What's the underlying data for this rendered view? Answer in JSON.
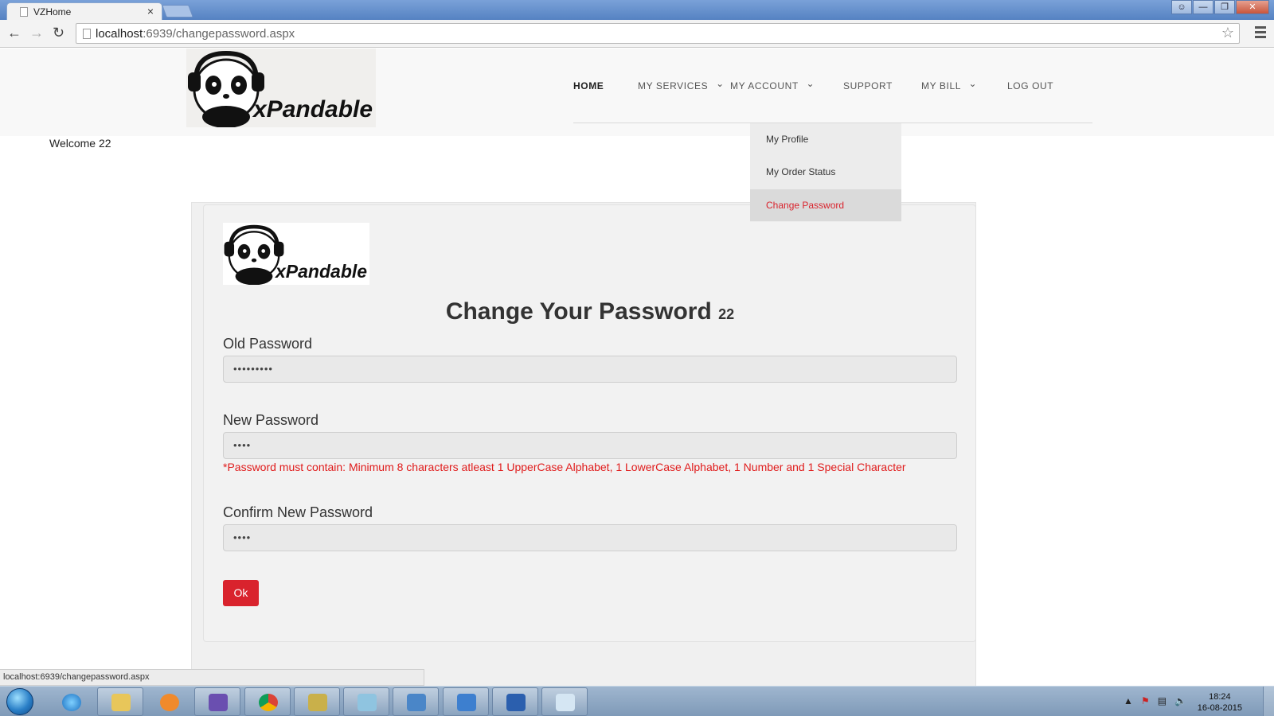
{
  "browser": {
    "tab_title": "VZHome",
    "tab_close": "×",
    "url_host": "localhost",
    "url_rest": ":6939/changepassword.aspx",
    "status_url": "localhost:6939/changepassword.aspx"
  },
  "header": {
    "logo_text": "xPandable",
    "nav": [
      {
        "label": "HOME",
        "active": true
      },
      {
        "label": "MY SERVICES",
        "caret": true
      },
      {
        "label": "MY ACCOUNT",
        "caret": true
      },
      {
        "label": "SUPPORT"
      },
      {
        "label": "MY BILL",
        "caret": true
      },
      {
        "label": "LOG OUT"
      }
    ],
    "caret": "⌄"
  },
  "welcome": "Welcome 22",
  "dropdown": {
    "items": [
      {
        "label": "My Profile"
      },
      {
        "label": "My Order Status"
      },
      {
        "label": "Change Password",
        "active": true
      }
    ]
  },
  "form": {
    "logo_text": "xPandable",
    "heading": "Change Your Password",
    "heading_user": "22",
    "old_label": "Old Password",
    "old_value": "•••••••••",
    "new_label": "New Password",
    "new_value": "••••",
    "error": "*Password must contain: Minimum 8 characters atleast 1 UpperCase Alphabet, 1 LowerCase Alphabet, 1 Number and 1 Special Character",
    "confirm_label": "Confirm New Password",
    "confirm_value": "••••",
    "ok_label": "Ok"
  },
  "taskbar": {
    "time": "18:24",
    "date": "16-08-2015"
  },
  "colors": {
    "accent": "#d9232d",
    "error": "#e01b1b"
  }
}
